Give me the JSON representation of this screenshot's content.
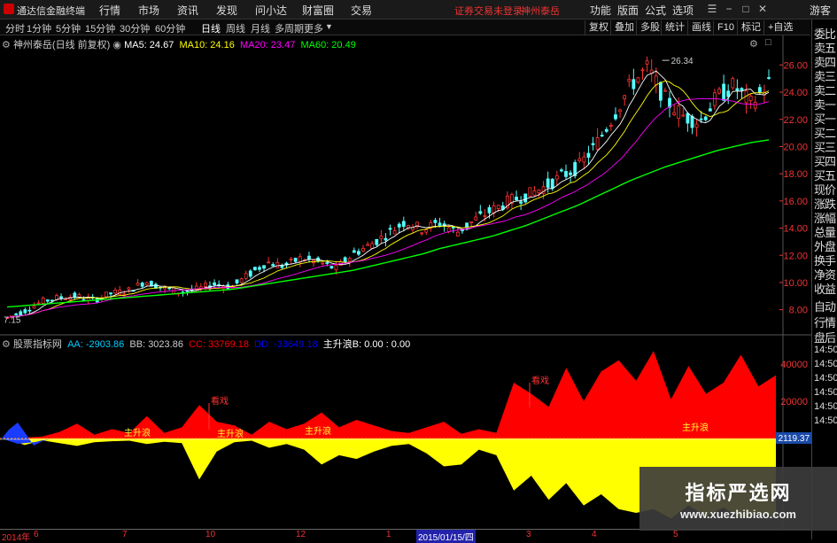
{
  "titlebar": {
    "app_title": "通达信金融终端",
    "menu": [
      "行情",
      "市场",
      "资讯",
      "发现",
      "问小达",
      "财富圈",
      "交易"
    ],
    "status": "证券交易未登录",
    "stock": "神州泰岳",
    "right_menu": [
      "功能",
      "版面",
      "公式",
      "选项"
    ],
    "guest": "游客"
  },
  "periodbar": {
    "periods": [
      "分时",
      "1分钟",
      "5分钟",
      "15分钟",
      "30分钟",
      "60分钟",
      "日线",
      "周线",
      "月线",
      "多周期",
      "更多"
    ],
    "tools": [
      "复权",
      "叠加",
      "多股",
      "统计",
      "画线",
      "F10",
      "标记",
      "+自选"
    ]
  },
  "rightpanel": {
    "items": [
      "委比",
      "卖五",
      "卖四",
      "卖三",
      "卖二",
      "卖一",
      "买一",
      "买二",
      "买三",
      "买四",
      "买五",
      "现价",
      "涨跌",
      "涨幅",
      "总量",
      "外盘",
      "换手",
      "净资",
      "收益",
      "自动",
      "行情",
      "盘后",
      "14:50",
      "14:50",
      "14:50",
      "14:50",
      "14:50",
      "14:50"
    ]
  },
  "price_legend": {
    "title": "神州泰岳(日线 前复权)",
    "ma5": "MA5: 24.67",
    "ma10": "MA10: 24.16",
    "ma20": "MA20: 23.47",
    "ma60": "MA60: 20.49",
    "colors": {
      "ma5": "#ffffff",
      "ma10": "#ffff00",
      "ma20": "#ff00ff",
      "ma60": "#00ff00"
    }
  },
  "indicator_legend": {
    "title": "股票指标网",
    "aa": "AA: -2903.86",
    "bb": "BB: 3023.86",
    "cc": "CC: 33769.18",
    "dd": "DD: -33649.18",
    "zsl": "主升浪B: 0.00 : 0.00"
  },
  "annotations": {
    "high": "26.34",
    "low": "7.15",
    "look1": "看戏",
    "look2": "看戏",
    "zsl1": "主升浪",
    "zsl2": "主升浪",
    "zsl3": "主升浪",
    "zsl4": "主升浪",
    "last_value": "2119.37"
  },
  "chart_data": [
    {
      "type": "candlestick",
      "title": "神州泰岳(日线 前复权)",
      "y_ticks": [
        8.0,
        10.0,
        12.0,
        14.0,
        16.0,
        18.0,
        20.0,
        22.0,
        24.0,
        26.0
      ],
      "ylim": [
        7.0,
        27.0
      ],
      "close_trend": [
        7.4,
        7.9,
        8.6,
        8.9,
        9.0,
        8.7,
        9.2,
        9.4,
        10.1,
        9.6,
        9.3,
        9.5,
        9.9,
        9.7,
        10.6,
        11.5,
        11.2,
        11.8,
        11.5,
        11.0,
        12.1,
        12.8,
        13.6,
        14.5,
        13.9,
        14.4,
        13.7,
        14.6,
        15.3,
        16.0,
        16.4,
        17.0,
        17.8,
        18.5,
        20.1,
        22.2,
        24.5,
        25.8,
        23.5,
        22.3,
        21.8,
        23.6,
        24.5,
        23.1,
        24.7
      ],
      "ma60": [
        8.2,
        8.3,
        8.4,
        8.5,
        8.6,
        8.7,
        8.8,
        8.9,
        9.0,
        9.1,
        9.2,
        9.3,
        9.4,
        9.5,
        9.7,
        9.9,
        10.1,
        10.3,
        10.5,
        10.7,
        10.9,
        11.2,
        11.5,
        11.8,
        12.1,
        12.5,
        12.8,
        13.1,
        13.4,
        13.8,
        14.2,
        14.7,
        15.2,
        15.7,
        16.3,
        16.9,
        17.5,
        18.0,
        18.5,
        18.9,
        19.3,
        19.7,
        20.0,
        20.3,
        20.49
      ],
      "high": 26.34,
      "low": 7.15
    },
    {
      "type": "area",
      "title": "股票指标网",
      "y_ticks": [
        20000,
        40000
      ],
      "series": [
        {
          "name": "CC",
          "color": "#ff0000",
          "values": [
            0,
            500,
            1000,
            3500,
            8000,
            2000,
            5000,
            3000,
            12000,
            3000,
            6000,
            18000,
            9000,
            7000,
            2000,
            9000,
            5000,
            8000,
            14000,
            6000,
            10000,
            7000,
            4000,
            3000,
            6000,
            9000,
            2500,
            5000,
            3000,
            30000,
            24000,
            17000,
            38000,
            20000,
            36000,
            42000,
            31000,
            47000,
            21000,
            39000,
            24000,
            30000,
            45000,
            28000,
            34000
          ]
        },
        {
          "name": "DD",
          "color": "#ffff00",
          "values": [
            0,
            -3500,
            -1000,
            -2500,
            -4000,
            -2000,
            -1500,
            -1200,
            -3000,
            -1800,
            -2500,
            -22000,
            -7000,
            -2000,
            -1200,
            -5000,
            -3000,
            -6000,
            -14000,
            -9000,
            -11000,
            -7000,
            -4000,
            -3000,
            -8000,
            -15000,
            -14000,
            -6000,
            -9000,
            -28000,
            -20000,
            -33000,
            -24000,
            -36000,
            -30000,
            -38000,
            -40000,
            -38000,
            -43000,
            -36000,
            -42000,
            -37000,
            -43000,
            -40000,
            -42000
          ]
        }
      ]
    }
  ],
  "date_labels": [
    "2014年",
    "6",
    "7",
    "10",
    "12",
    "1",
    "2015/01/15/四",
    "3",
    "4",
    "5"
  ],
  "watermark": {
    "line1": "指标严选网",
    "line2": "www.xuezhibiao.com"
  }
}
